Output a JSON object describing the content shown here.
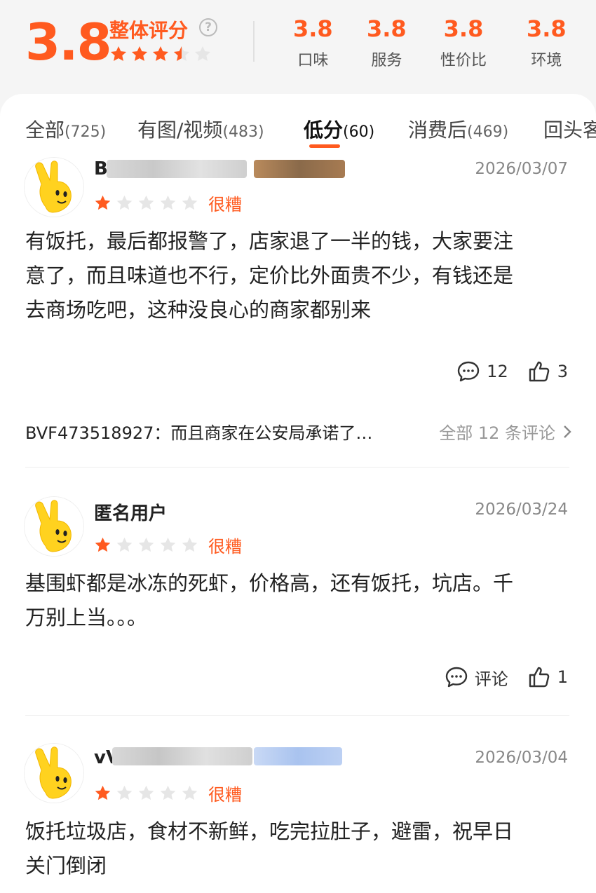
{
  "summary": {
    "overall_score": "3.8",
    "overall_label": "整体评分",
    "overall_rating": 3.5,
    "sub_scores": [
      {
        "value": "3.8",
        "label": "口味"
      },
      {
        "value": "3.8",
        "label": "服务"
      },
      {
        "value": "3.8",
        "label": "性价比"
      },
      {
        "value": "3.8",
        "label": "环境"
      }
    ]
  },
  "tabs": [
    {
      "label": "全部",
      "count": "(725)"
    },
    {
      "label": "有图/视频",
      "count": "(483)"
    },
    {
      "label": "低分",
      "count": "(60)",
      "active": true
    },
    {
      "label": "消费后",
      "count": "(469)"
    },
    {
      "label": "回头客",
      "count": ""
    }
  ],
  "reviews": [
    {
      "username": "B",
      "date": "2026/03/07",
      "rating": 1,
      "rating_text": "很糟",
      "text_lines": [
        "有饭托，最后都报警了，店家退了一半的钱，大家要注",
        "意了，而且味道也不行，定价比外面贵不少，有钱还是",
        "去商场吃吧，这种没良心的商家都别来"
      ],
      "comments_label": "12",
      "likes": "3",
      "top_comment": {
        "user": "BVF473518927：",
        "text": "而且商家在公安局承诺了…",
        "more": "全部 12 条评论"
      }
    },
    {
      "username": "匿名用户",
      "date": "2026/03/24",
      "rating": 1,
      "rating_text": "很糟",
      "text_lines": [
        "基围虾都是冰冻的死虾，价格高，还有饭托，坑店。千",
        "万别上当。。。"
      ],
      "comments_label": "评论",
      "likes": "1"
    },
    {
      "username": "vV",
      "date": "2026/03/04",
      "rating": 1,
      "rating_text": "很糟",
      "text_lines": [
        "饭托垃圾店，食材不新鲜，吃完拉肚子，避雷，祝早日",
        "关门倒闭"
      ]
    }
  ],
  "colors": {
    "accent": "#ff5a1f",
    "star_empty": "#e6e6e6"
  }
}
